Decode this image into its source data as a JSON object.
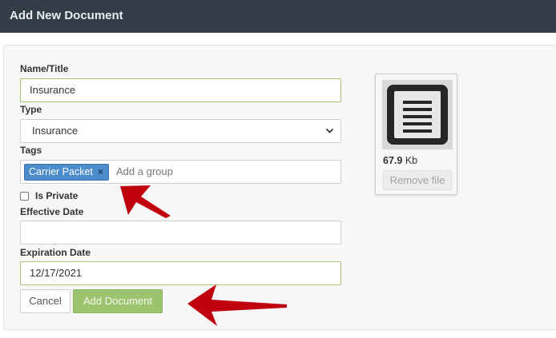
{
  "header": {
    "title": "Add New Document"
  },
  "form": {
    "name_label": "Name/Title",
    "name_value": "Insurance",
    "type_label": "Type",
    "type_value": "Insurance",
    "tags_label": "Tags",
    "tags": [
      {
        "label": "Carrier Packet",
        "remove": "×"
      }
    ],
    "tags_placeholder": "Add a group",
    "is_private_label": "Is Private",
    "is_private_checked": false,
    "effective_label": "Effective Date",
    "effective_value": "",
    "expiration_label": "Expiration Date",
    "expiration_value": "12/17/2021",
    "cancel_label": "Cancel",
    "add_label": "Add Document"
  },
  "file": {
    "size_value": "67.9",
    "size_unit": "Kb",
    "remove_label": "Remove file"
  },
  "colors": {
    "header_bg": "#323d47",
    "tag_chip": "#4a8ccc",
    "add_button": "#9cc46f",
    "annotation_arrow": "#c0000f"
  }
}
